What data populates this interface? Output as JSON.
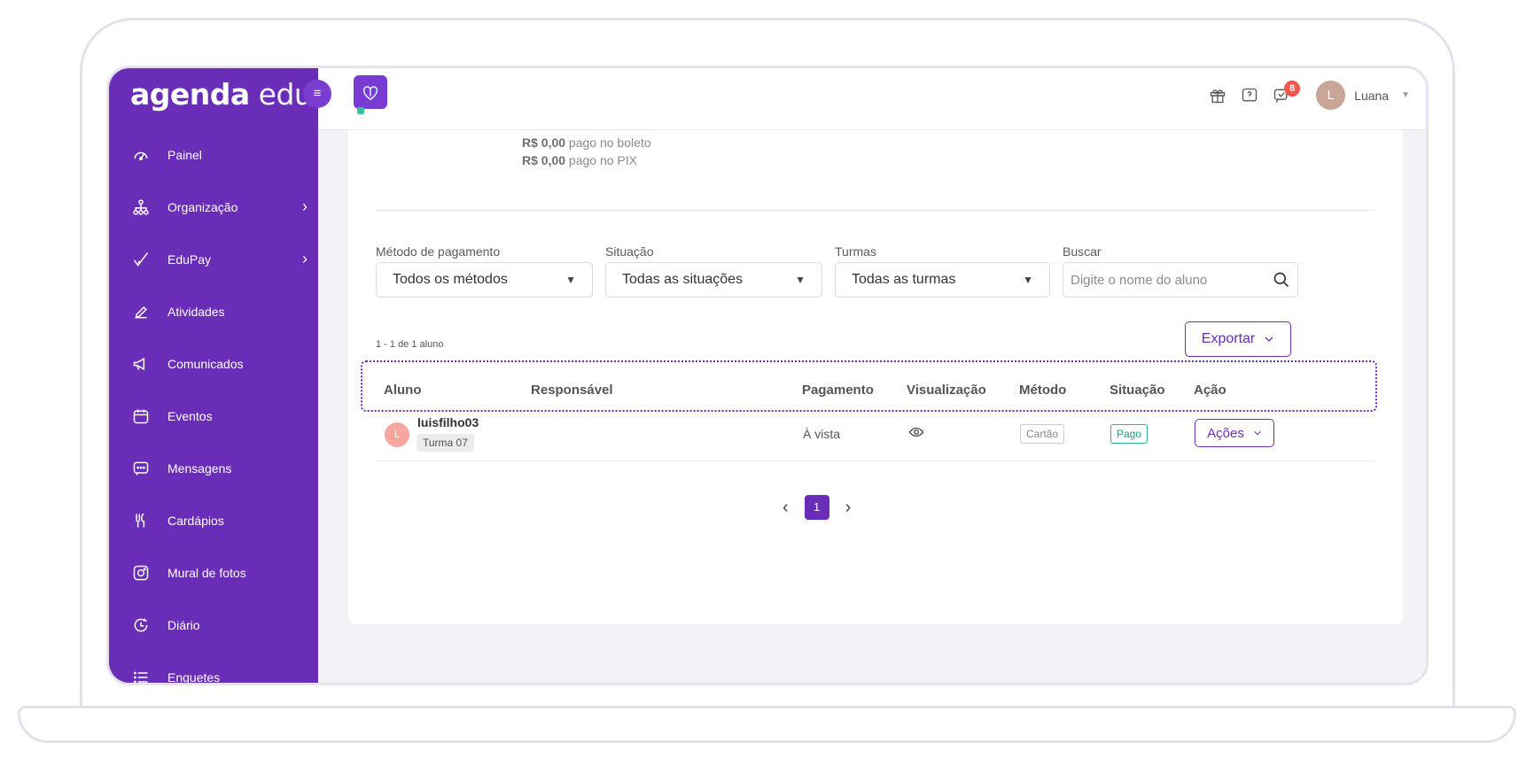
{
  "app": {
    "logo_bold": "agenda",
    "logo_light": "edu"
  },
  "sidebar": {
    "toggle_icon": "≡",
    "items": [
      {
        "label": "Painel",
        "icon": "gauge-icon"
      },
      {
        "label": "Organização",
        "icon": "org-chart-icon",
        "has_submenu": true
      },
      {
        "label": "EduPay",
        "icon": "checkmark-icon",
        "has_submenu": true
      },
      {
        "label": "Atividades",
        "icon": "pencil-icon"
      },
      {
        "label": "Comunicados",
        "icon": "megaphone-icon"
      },
      {
        "label": "Eventos",
        "icon": "calendar-icon"
      },
      {
        "label": "Mensagens",
        "icon": "chat-icon"
      },
      {
        "label": "Cardápios",
        "icon": "cutlery-icon"
      },
      {
        "label": "Mural de fotos",
        "icon": "camera-icon"
      },
      {
        "label": "Diário",
        "icon": "clock-icon"
      },
      {
        "label": "Enquetes",
        "icon": "list-icon"
      }
    ]
  },
  "topbar": {
    "notification_count": "8",
    "avatar_initial": "L",
    "user_name": "Luana"
  },
  "summary": {
    "line1_amount": "R$ 0,00",
    "line1_text": " pago no boleto",
    "line2_amount": "R$ 0,00",
    "line2_text": " pago no PIX"
  },
  "filters": {
    "payment_method": {
      "label": "Método de pagamento",
      "value": "Todos os métodos"
    },
    "status": {
      "label": "Situação",
      "value": "Todas as situações"
    },
    "classes": {
      "label": "Turmas",
      "value": "Todas as turmas"
    },
    "search": {
      "label": "Buscar",
      "placeholder": "Digite o nome do aluno"
    }
  },
  "results": {
    "count_text": "1 - 1 de 1 aluno",
    "export_label": "Exportar"
  },
  "table": {
    "headers": {
      "student": "Aluno",
      "guardian": "Responsável",
      "payment": "Pagamento",
      "view": "Visualização",
      "method": "Método",
      "status": "Situação",
      "action": "Ação"
    },
    "rows": [
      {
        "avatar_initial": "L",
        "student": "luisfilho03",
        "class": "Turma 07",
        "guardian": "",
        "payment": "À vista",
        "method": "Cartão",
        "status": "Pago",
        "action_label": "Ações"
      }
    ]
  },
  "pagination": {
    "current_page": "1"
  },
  "colors": {
    "brand": "#6a2db8",
    "paid": "#2bb594",
    "notification": "#f4574a"
  }
}
